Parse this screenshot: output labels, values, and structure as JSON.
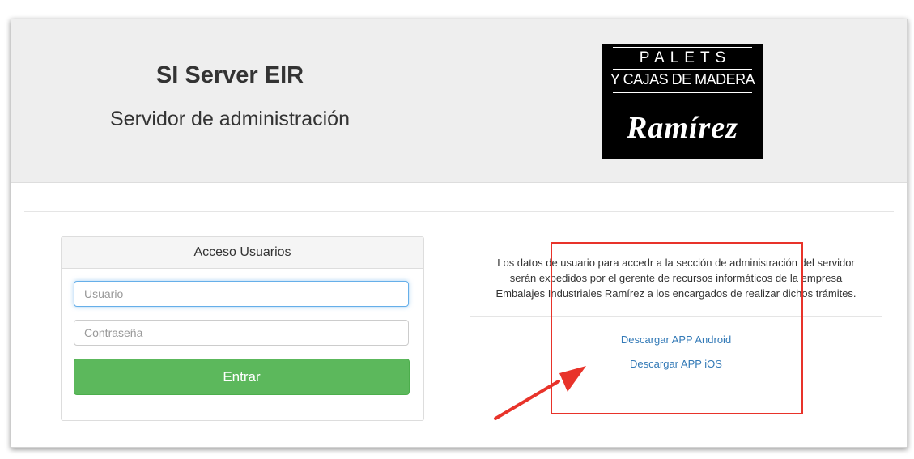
{
  "header": {
    "title": "SI Server EIR",
    "subtitle": "Servidor de administración",
    "logo": {
      "line1": "PALETS",
      "line2": "Y CAJAS DE MADERA",
      "brand": "Ramírez"
    }
  },
  "login": {
    "heading": "Acceso Usuarios",
    "user_placeholder": "Usuario",
    "password_placeholder": "Contraseña",
    "submit_label": "Entrar"
  },
  "info": {
    "line1": "Los datos de usuario para accedr a la sección de administración del servidor",
    "line2": "serán expedidos por el gerente de recursos informáticos de la empresa",
    "line3": "Embalajes Industriales Ramírez a los encargados de realizar dichos trámites."
  },
  "downloads": {
    "android": "Descargar APP Android",
    "ios": "Descargar APP iOS"
  },
  "colors": {
    "header_bg": "#eeeeee",
    "primary_button": "#5cb85c",
    "link": "#337ab7",
    "annotation": "#e8332a",
    "focus_border": "#66afe9"
  },
  "icons": {
    "annotation_arrow": "red-arrow-icon"
  }
}
